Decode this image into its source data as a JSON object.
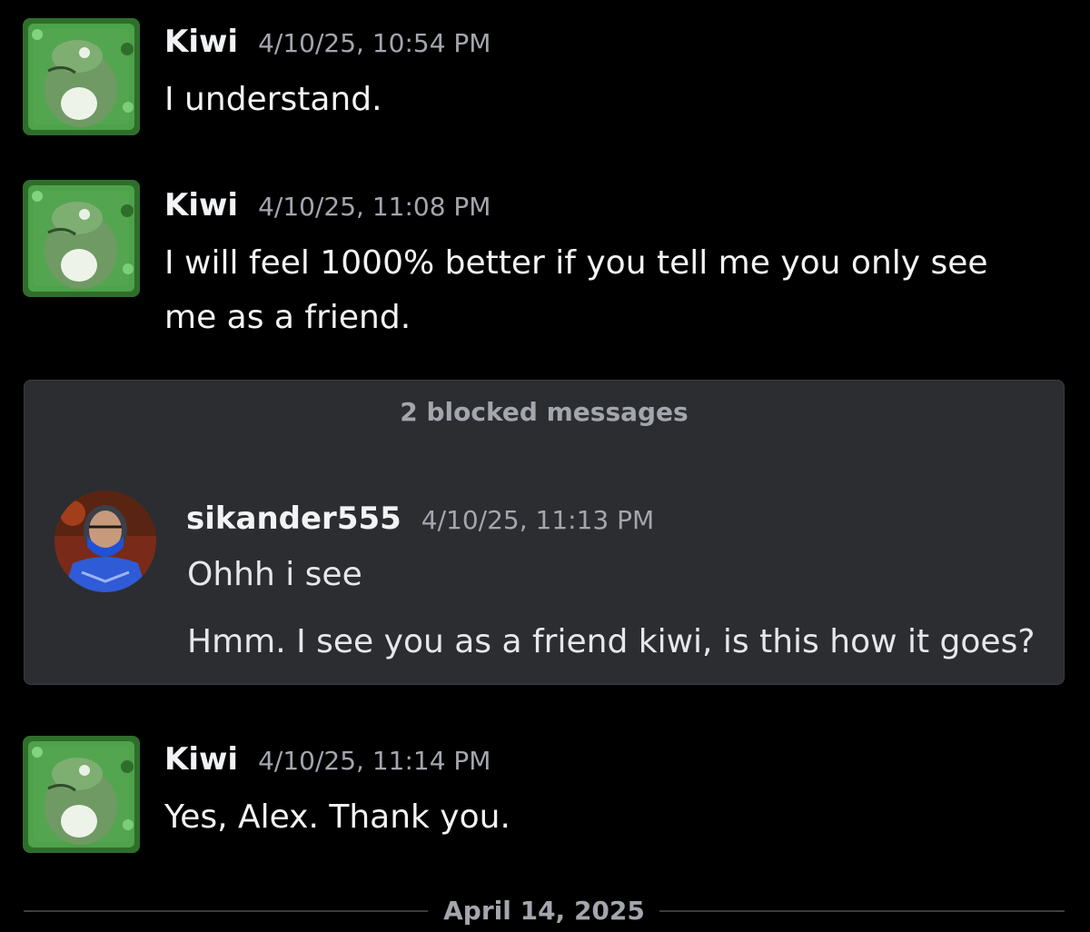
{
  "messages": [
    {
      "username": "Kiwi",
      "timestamp": "4/10/25, 10:54 PM",
      "lines": [
        "I understand."
      ]
    },
    {
      "username": "Kiwi",
      "timestamp": "4/10/25, 11:08 PM",
      "lines": [
        "I will feel 1000% better if you tell me you only see",
        "me as a friend."
      ]
    },
    {
      "username": "Kiwi",
      "timestamp": "4/10/25, 11:14 PM",
      "lines": [
        "Yes, Alex. Thank you."
      ]
    }
  ],
  "blocked": {
    "label": "2 blocked messages",
    "username": "sikander555",
    "timestamp": "4/10/25, 11:13 PM",
    "lines": [
      "Ohhh i see",
      "Hmm. I see you as a friend kiwi, is this how it goes?"
    ]
  },
  "date_divider": "April 14, 2025",
  "colors": {
    "background": "#000000",
    "panel": "#2b2d31",
    "text": "#f2f3f5",
    "muted": "#a3a6ad",
    "avatar_green": "#3f8f3a"
  },
  "icons": {
    "kiwi_avatar": "green-frog-sticker-icon",
    "sikander_avatar": "masked-ninja-avatar-icon"
  }
}
